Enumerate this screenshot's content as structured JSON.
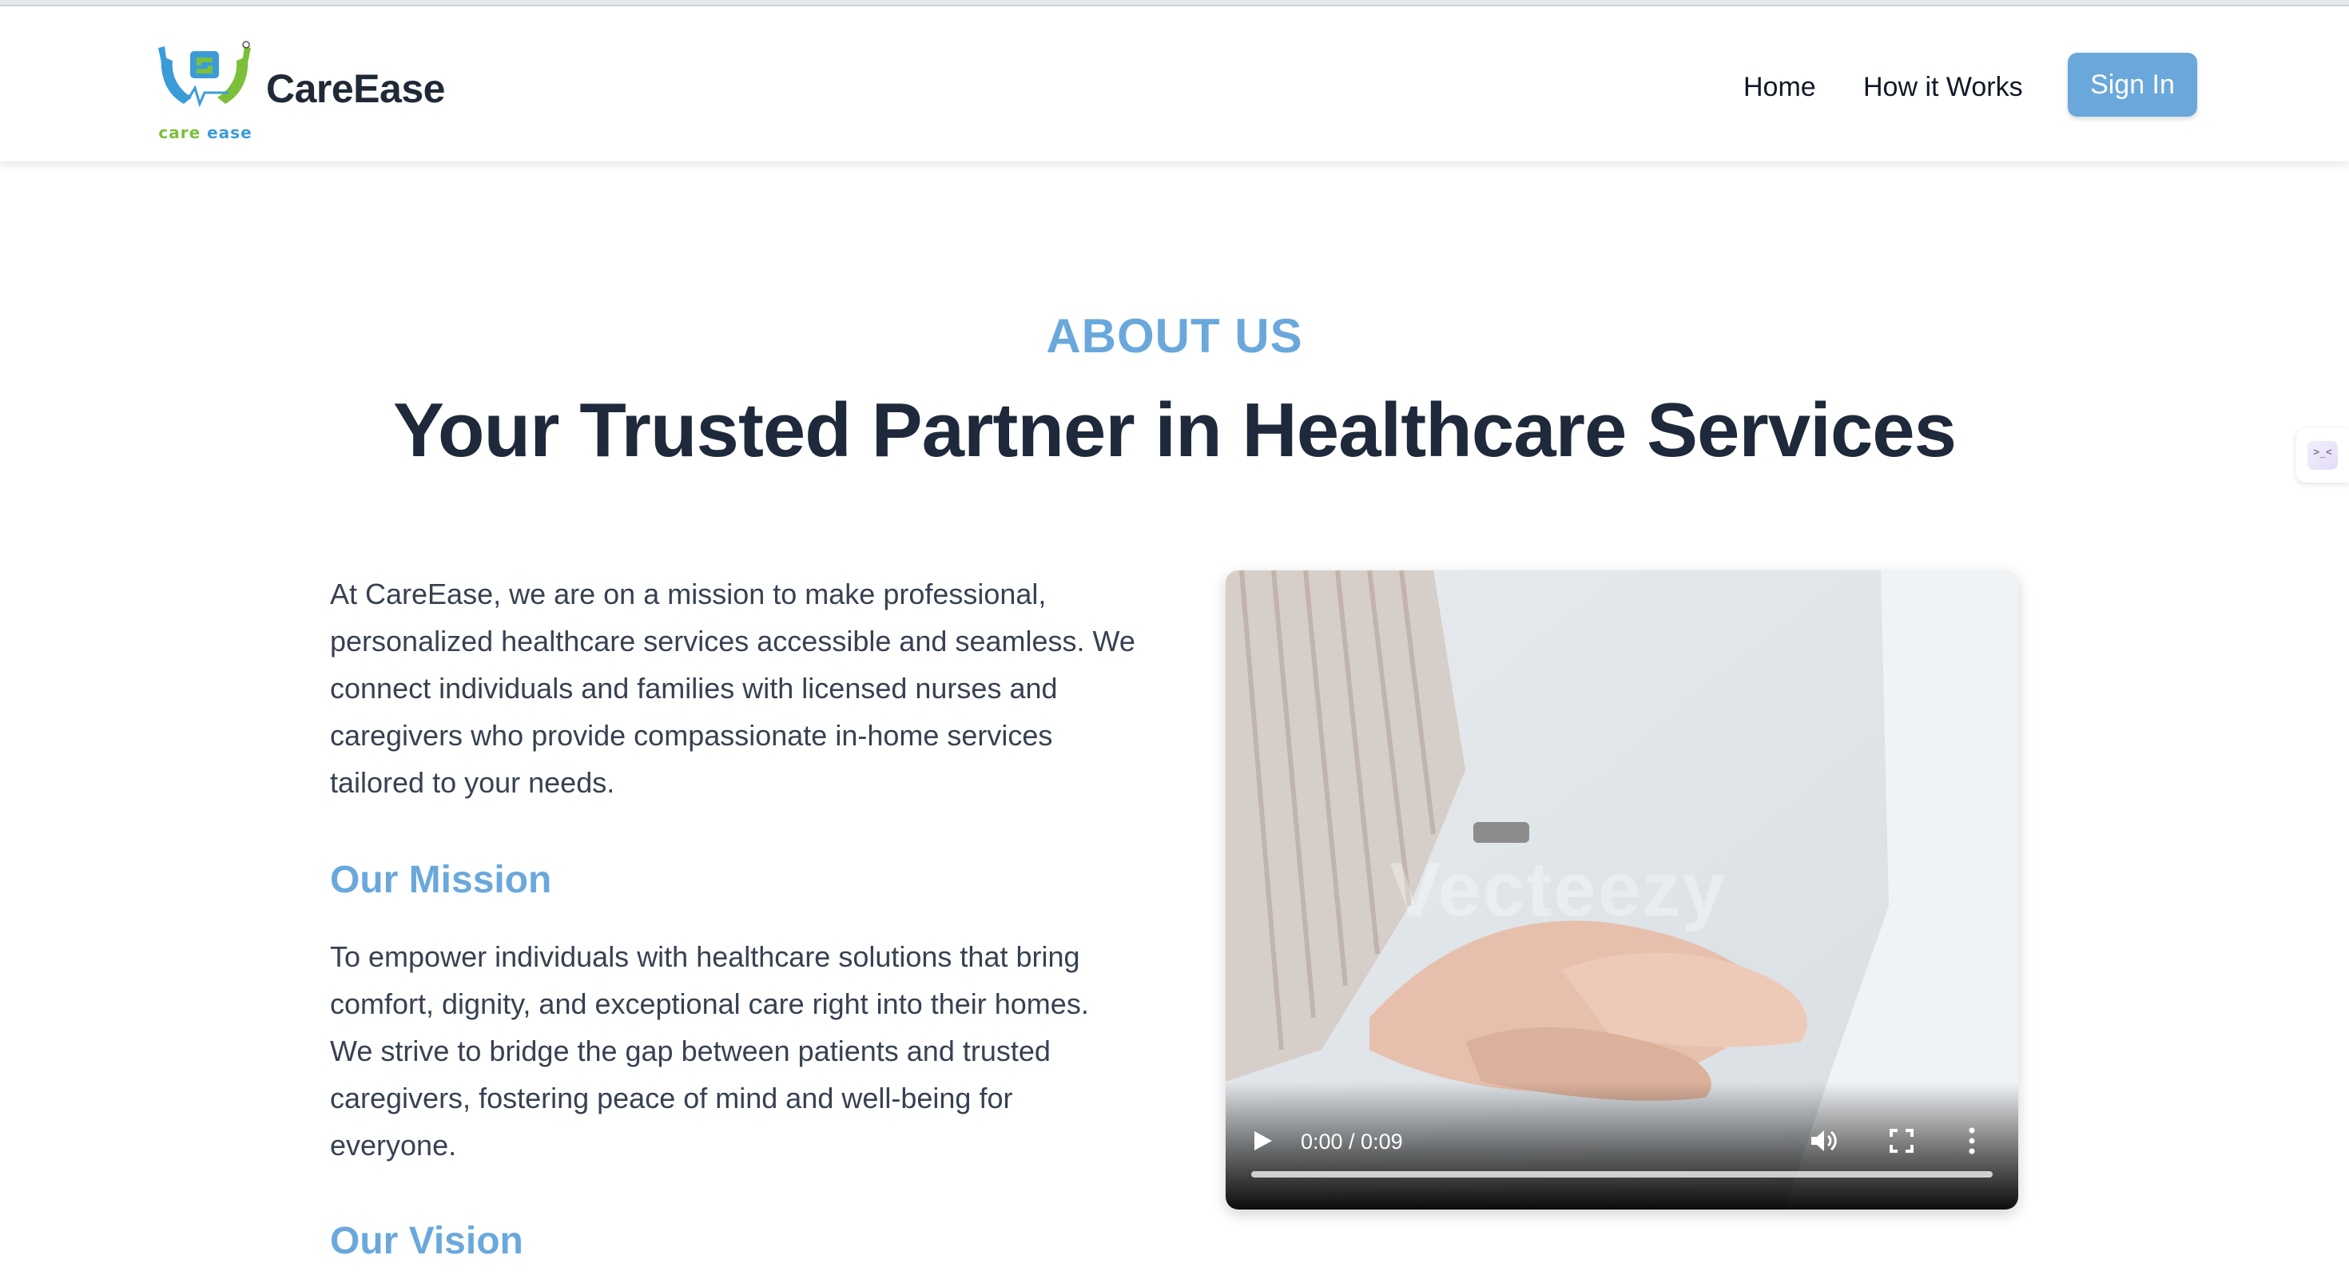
{
  "header": {
    "brand": "CareEase",
    "logo_caption_part1": "care",
    "logo_caption_part2": "ease",
    "nav": {
      "home": "Home",
      "how_it_works": "How it Works",
      "sign_in": "Sign In"
    }
  },
  "side_widget": {
    "glyph": ">_<"
  },
  "about": {
    "eyebrow": "ABOUT US",
    "headline": "Your Trusted Partner in Healthcare Services",
    "intro": "At CareEase, we are on a mission to make professional, personalized healthcare services accessible and seamless. We connect individuals and families with licensed nurses and caregivers who provide compassionate in-home services tailored to your needs.",
    "mission_title": "Our Mission",
    "mission_text": "To empower individuals with healthcare solutions that bring comfort, dignity, and exceptional care right into their homes. We strive to bridge the gap between patients and trusted caregivers, fostering peace of mind and well-being for everyone.",
    "vision_title": "Our Vision"
  },
  "video": {
    "watermark": "Vecteezy",
    "time": "0:00 / 0:09",
    "progress": 0
  },
  "colors": {
    "accent": "#6aa8dc",
    "heading": "#1e293b",
    "body": "#374151"
  }
}
